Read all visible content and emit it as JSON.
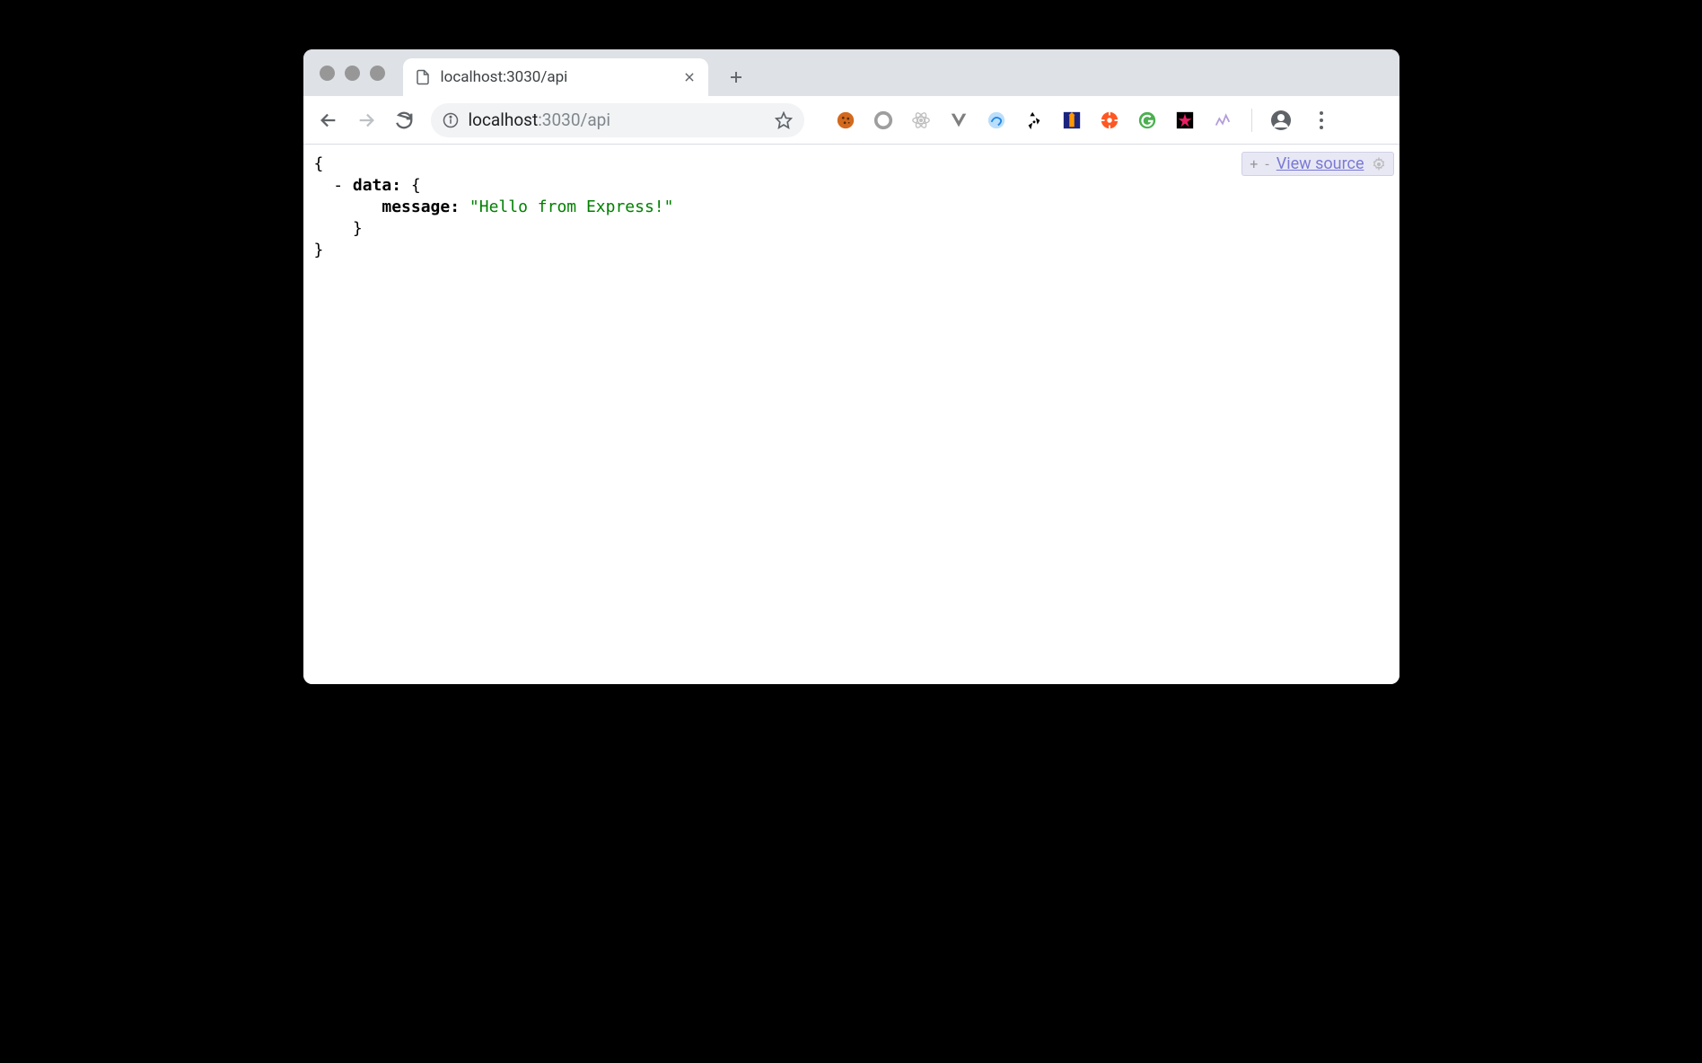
{
  "tab": {
    "title": "localhost:3030/api"
  },
  "url": {
    "host": "localhost",
    "rest": ":3030/api"
  },
  "json": {
    "open_brace": "{",
    "collapser": "-",
    "data_key": "data:",
    "data_open": "{",
    "message_key": "message:",
    "message_value": "\"Hello from Express!\"",
    "data_close": "}",
    "close_brace": "}"
  },
  "source_bar": {
    "plus": "+",
    "minus": "-",
    "view_source": "View source"
  },
  "ext_colors": {
    "cookie": "#d2691e",
    "ring": "#9e9e9e",
    "react": "#c0c0c0",
    "vue": "#7f7f7f",
    "circle_blue": "#1e88e5",
    "recycle": "#000",
    "lighthouse_bg": "#1a237e",
    "lighthouse_fg": "#ff9800",
    "orange_circle": "#ff5722",
    "green_circle": "#4caf50",
    "star_bg": "#000",
    "misc": "#b0bec5"
  }
}
